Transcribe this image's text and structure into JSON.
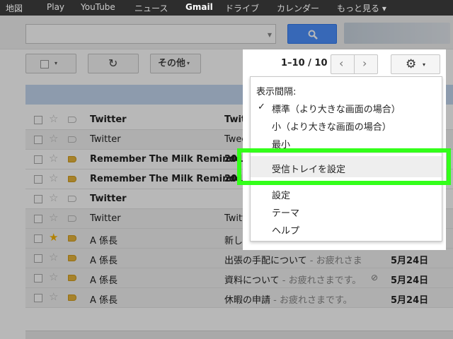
{
  "topnav": {
    "items": [
      "地図",
      "Play",
      "YouTube",
      "ニュース",
      "Gmail",
      "ドライブ",
      "カレンダー",
      "もっと見る ▾"
    ]
  },
  "search": {
    "placeholder": ""
  },
  "toolbar": {
    "refresh_icon": "↻",
    "more_label": "その他",
    "caret": "▾"
  },
  "pager": {
    "range": "1–10 / 10",
    "prev": "‹",
    "next": "›"
  },
  "settings": {
    "gear_icon": "⚙",
    "caret": "▾"
  },
  "menu": {
    "heading": "表示間隔:",
    "check": "✓",
    "density": [
      "標準（より大きな画面の場合）",
      "小（より大きな画面の場合）",
      "最小"
    ],
    "inbox_settings": "受信トレイを設定",
    "items": [
      "設定",
      "テーマ",
      "ヘルプ"
    ]
  },
  "emails": [
    {
      "sender": "Twitter",
      "subject_bold": "Twitter",
      "subject_snippet": "",
      "date": "",
      "unread": true,
      "starred": false,
      "important": false
    },
    {
      "sender": "Twitter",
      "subject_bold": "Tweet",
      "subject_snippet": "",
      "date": "",
      "unread": false,
      "starred": false,
      "important": false
    },
    {
      "sender": "Remember The Milk Reminder",
      "subject_bold": "2013",
      "subject_snippet": "",
      "date": "",
      "unread": true,
      "starred": false,
      "important": true
    },
    {
      "sender": "Remember The Milk Reminder",
      "subject_bold": "2013",
      "subject_snippet": "",
      "date": "",
      "unread": true,
      "starred": false,
      "important": true
    },
    {
      "sender": "Twitter",
      "subject_bold": "",
      "subject_snippet": "",
      "date": "",
      "unread": true,
      "starred": false,
      "important": false
    },
    {
      "sender": "Twitter",
      "subject_bold": "Twitter",
      "subject_snippet": "",
      "date": "",
      "unread": false,
      "starred": false,
      "important": false
    },
    {
      "sender": "A 係長",
      "subject_bold": "新しい",
      "subject_snippet": "",
      "date": "",
      "unread": false,
      "starred": true,
      "important": true
    },
    {
      "sender": "A 係長",
      "subject_bold": "出張の手配について",
      "subject_snippet": " - お疲れさま",
      "date": "5月24日",
      "unread": false,
      "starred": false,
      "important": true
    },
    {
      "sender": "A 係長",
      "subject_bold": "資料について",
      "subject_snippet": " - お疲れさまです。",
      "date": "5月24日",
      "unread": false,
      "starred": false,
      "important": true,
      "attachment": "⊘"
    },
    {
      "sender": "A 係長",
      "subject_bold": "休暇の申請",
      "subject_snippet": " - お疲れさまです。",
      "date": "5月24日",
      "unread": false,
      "starred": false,
      "important": true
    }
  ],
  "colors": {
    "highlight_box": "#33ff1a",
    "search_button": "#4d90fe",
    "important_label": "#e6b53c",
    "star_on": "#f7b300"
  }
}
